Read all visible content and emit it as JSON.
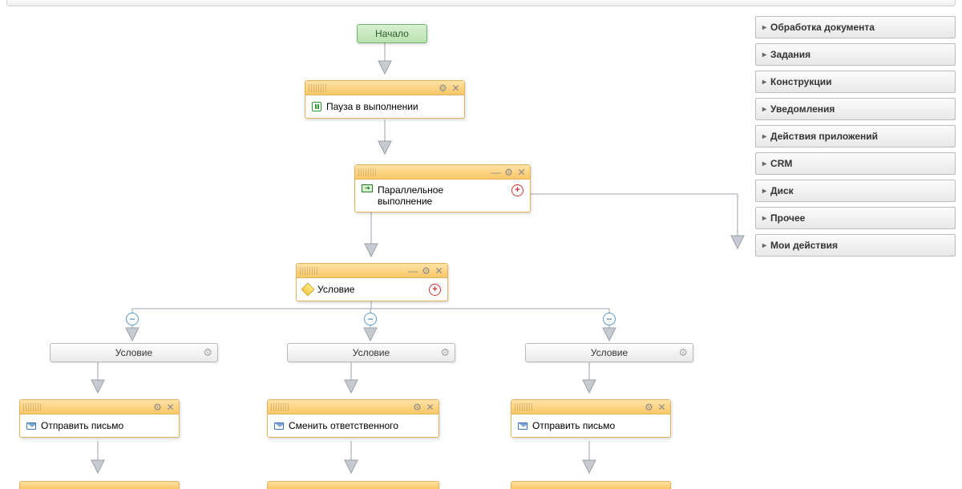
{
  "flow": {
    "start": "Начало",
    "pause": "Пауза в выполнении",
    "parallel": "Параллельное выполнение",
    "condition": "Условие",
    "branch1_button": "Условие",
    "branch2_button": "Условие",
    "branch3_button": "Условие",
    "branch1_action": "Отправить письмо",
    "branch2_action": "Сменить ответственного",
    "branch3_action": "Отправить письмо"
  },
  "sidebar": {
    "items": [
      "Обработка документа",
      "Задания",
      "Конструкции",
      "Уведомления",
      "Действия приложений",
      "CRM",
      "Диск",
      "Прочее",
      "Мои действия"
    ]
  }
}
